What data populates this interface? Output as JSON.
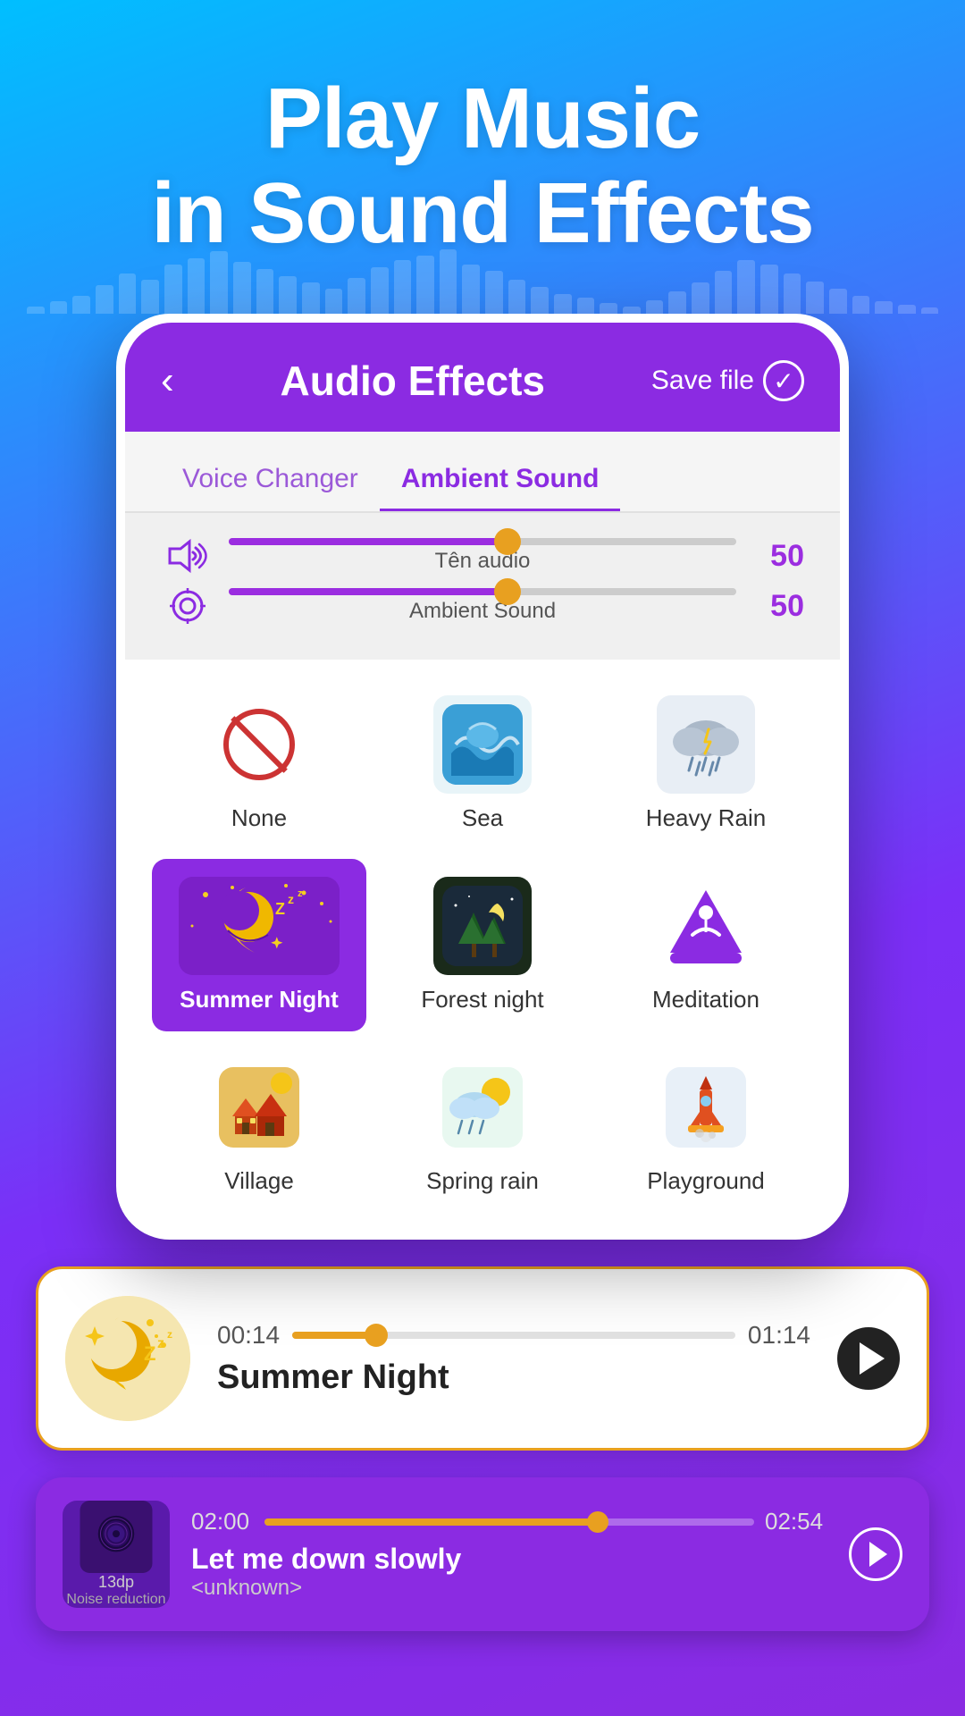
{
  "header": {
    "title_line1": "Play Music",
    "title_line2": "in Sound Effects"
  },
  "app": {
    "title": "Audio Effects",
    "back_label": "‹",
    "save_file_label": "Save file",
    "tabs": [
      {
        "label": "Voice Changer",
        "active": false
      },
      {
        "label": "Ambient Sound",
        "active": true
      }
    ],
    "sliders": [
      {
        "icon": "volume-icon",
        "label": "Tên audio",
        "value": "50",
        "percent": 55
      },
      {
        "icon": "ambient-icon",
        "label": "Ambient Sound",
        "value": "50",
        "percent": 55
      }
    ],
    "sounds": [
      {
        "id": "none",
        "label": "None",
        "icon": "none-icon",
        "active": false
      },
      {
        "id": "sea",
        "label": "Sea",
        "icon": "sea-icon",
        "active": false
      },
      {
        "id": "heavy-rain",
        "label": "Heavy Rain",
        "icon": "rain-icon",
        "active": false
      },
      {
        "id": "summer-night",
        "label": "Summer Night",
        "icon": "moon-icon",
        "active": true
      },
      {
        "id": "forest-night",
        "label": "Forest night",
        "icon": "forest-icon",
        "active": false
      },
      {
        "id": "meditation",
        "label": "Meditation",
        "icon": "meditation-icon",
        "active": false
      },
      {
        "id": "village",
        "label": "Village",
        "icon": "village-icon",
        "active": false
      },
      {
        "id": "spring-rain",
        "label": "Spring rain",
        "icon": "spring-icon",
        "active": false
      },
      {
        "id": "playground",
        "label": "Playground",
        "icon": "playground-icon",
        "active": false
      }
    ]
  },
  "player1": {
    "thumb_emoji": "🌙",
    "time_current": "00:14",
    "time_total": "01:14",
    "progress_percent": 19,
    "title": "Summer Night"
  },
  "player2": {
    "thumb_label": "13dp",
    "thumb_sublabel": "Noise reduction",
    "time_current": "02:00",
    "time_total": "02:54",
    "progress_percent": 68,
    "song": "Let me down slowly",
    "artist": "<unknown>"
  },
  "eq_bars": [
    8,
    14,
    20,
    32,
    45,
    38,
    55,
    62,
    70,
    58,
    50,
    42,
    35,
    28,
    40,
    52,
    60,
    65,
    72,
    55,
    48,
    38,
    30,
    22,
    18,
    12,
    8,
    15,
    25,
    35,
    48,
    60,
    55,
    45,
    36,
    28,
    20,
    14,
    10,
    7
  ]
}
